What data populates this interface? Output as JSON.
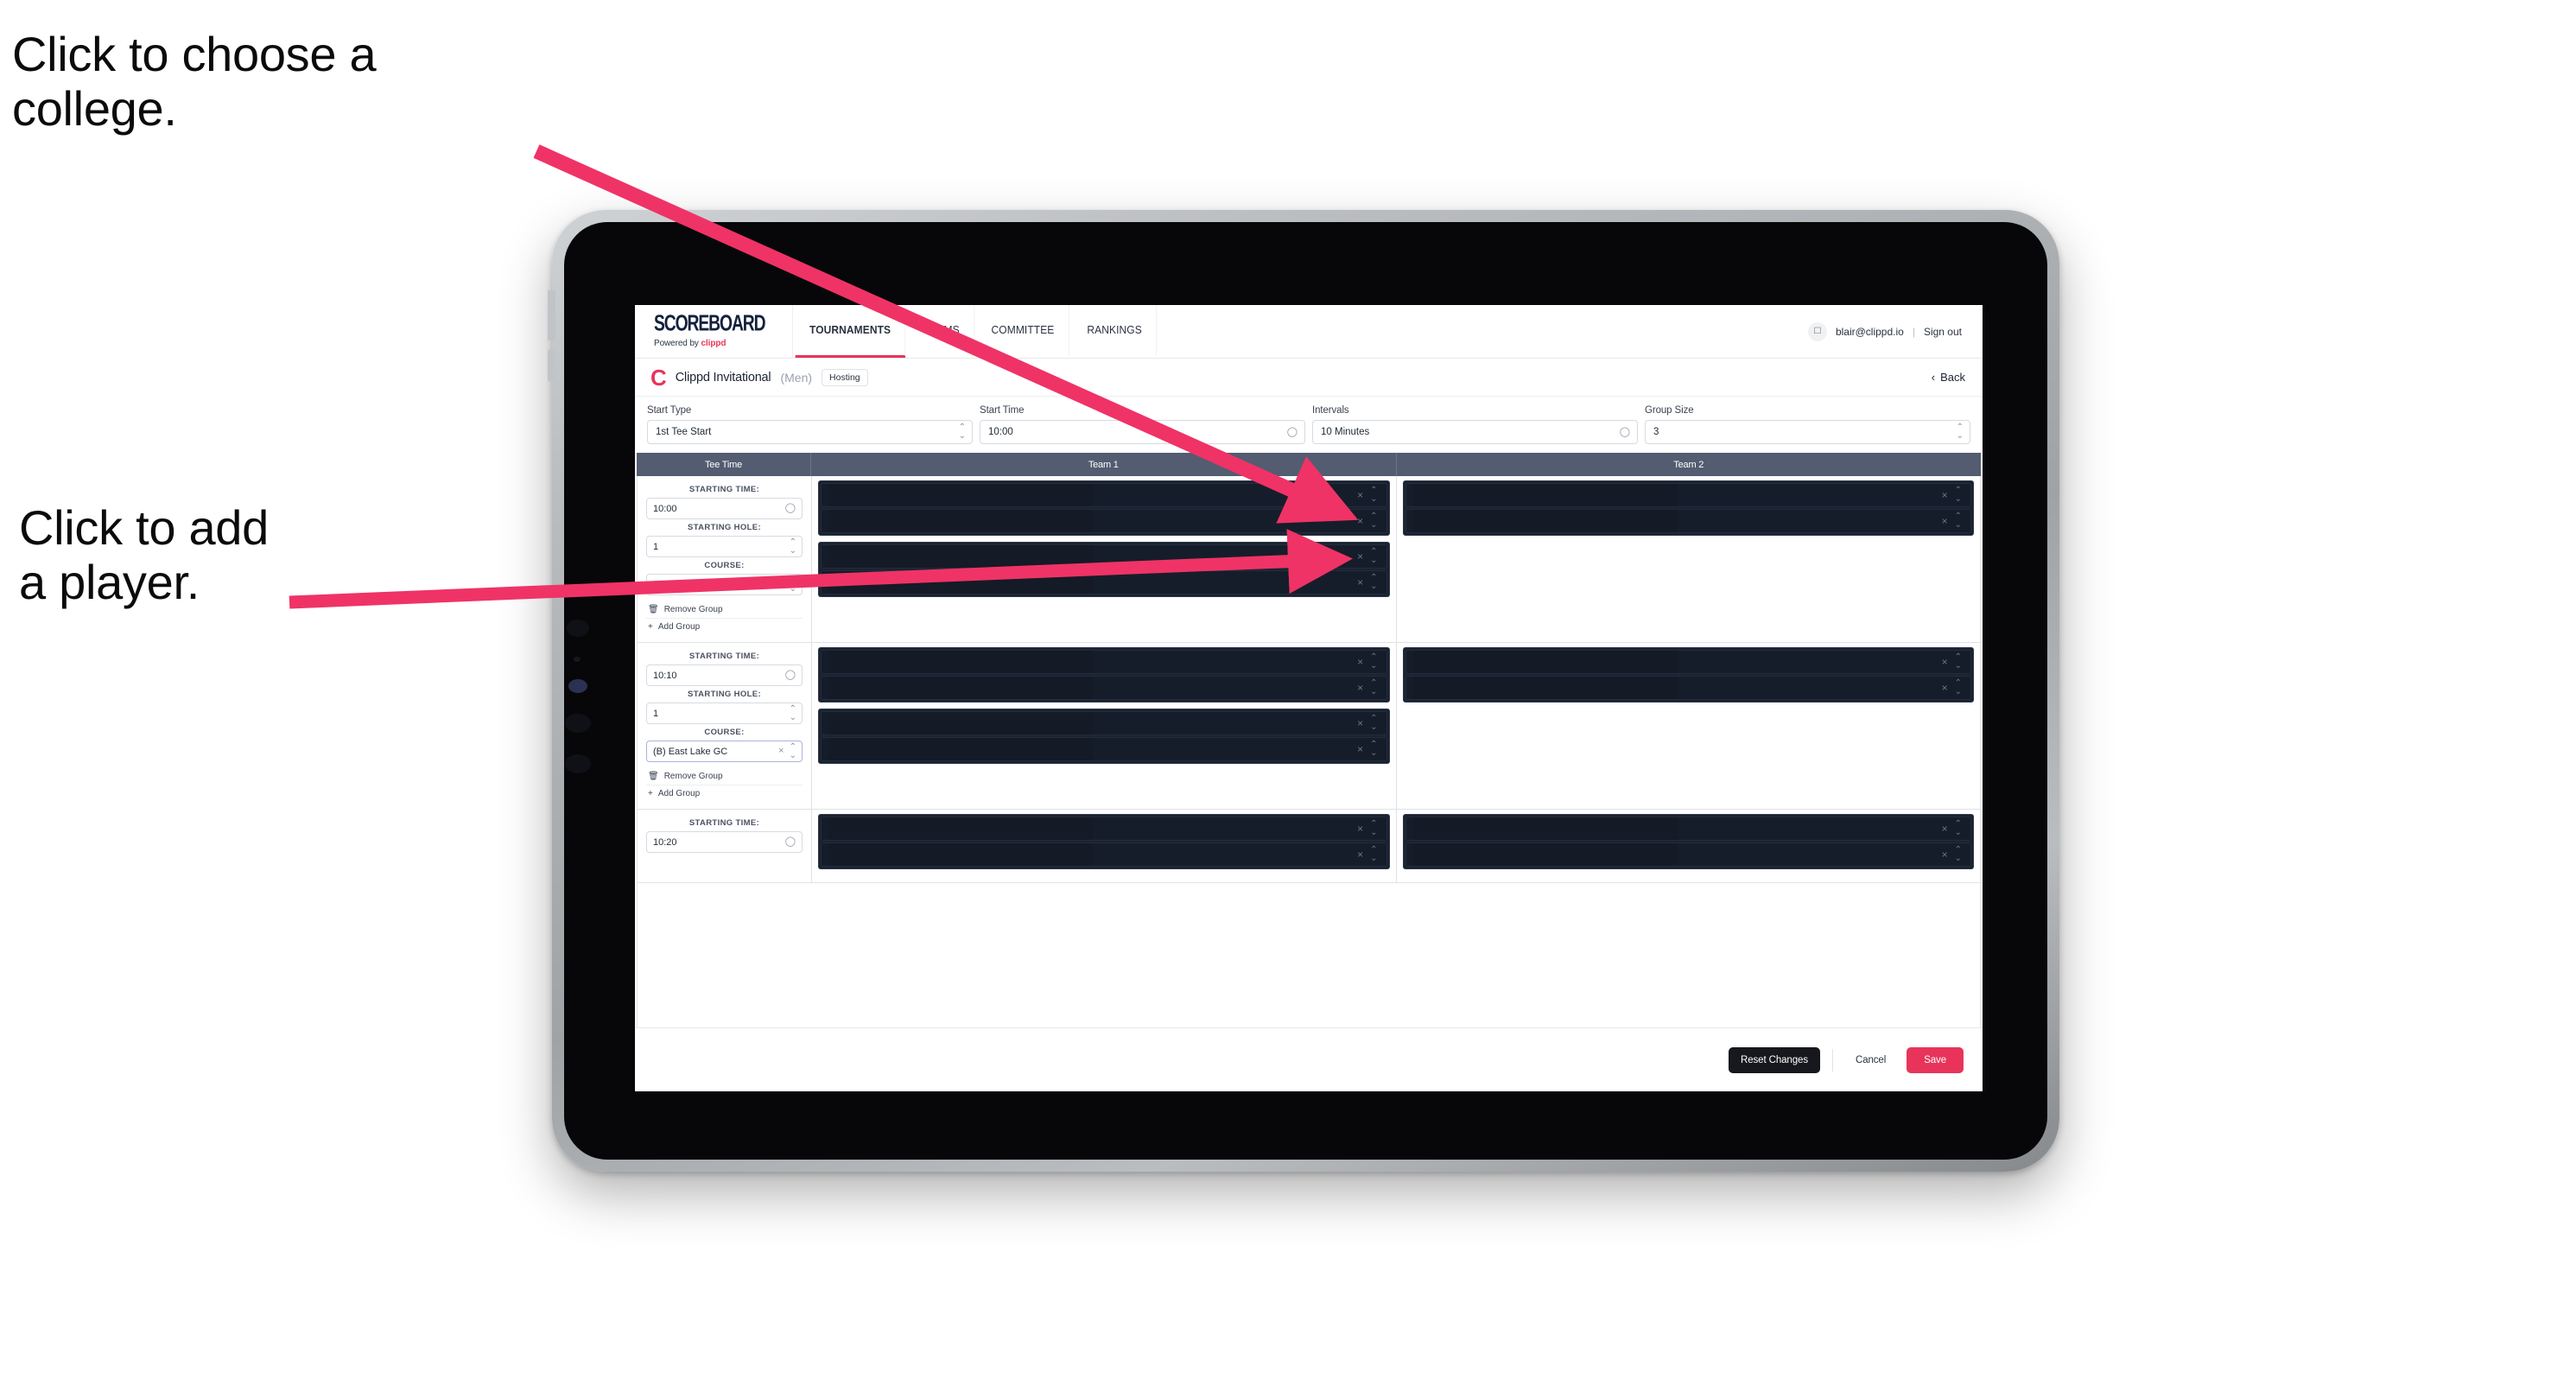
{
  "annotations": [
    {
      "id": "college",
      "text": "Click to choose a\ncollege."
    },
    {
      "id": "player",
      "text": "Click to add\na player."
    }
  ],
  "colors": {
    "accent": "#e8345a",
    "arrow": "#ef3366",
    "table_header_bg": "#535c70",
    "redact_dark": "#161d2a",
    "reset_button_bg": "#16181d"
  },
  "topnav": {
    "brand_name": "SCOREBOARD",
    "brand_sub_prefix": "Powered by ",
    "brand_sub_brand": "clippd",
    "links": [
      {
        "label": "TOURNAMENTS",
        "active": true
      },
      {
        "label": "TEAMS",
        "active": false
      },
      {
        "label": "COMMITTEE",
        "active": false
      },
      {
        "label": "RANKINGS",
        "active": false
      }
    ],
    "avatar_icon": "user-avatar-icon",
    "user_email": "blair@clippd.io",
    "separator": "|",
    "sign_out": "Sign out"
  },
  "subheader": {
    "logo_letter": "C",
    "tournament_name": "Clippd Invitational",
    "gender": "(Men)",
    "hosting_badge": "Hosting",
    "back_chevron": "‹",
    "back_label": "Back"
  },
  "controls": [
    {
      "label": "Start Type",
      "value": "1st Tee Start",
      "icon": "stepper-icon"
    },
    {
      "label": "Start Time",
      "value": "10:00",
      "icon": "clock-icon"
    },
    {
      "label": "Intervals",
      "value": "10 Minutes",
      "icon": "clock-icon"
    },
    {
      "label": "Group Size",
      "value": "3",
      "icon": "stepper-icon"
    }
  ],
  "table": {
    "headers": [
      "Tee Time",
      "Team 1",
      "Team 2"
    ],
    "field_labels": {
      "starting_time": "STARTING TIME:",
      "starting_hole": "STARTING HOLE:",
      "course": "COURSE:"
    },
    "group_actions": {
      "remove": "Remove Group",
      "remove_icon": "trash-icon",
      "add": "Add Group",
      "add_icon": "plus-icon"
    },
    "row_icons": {
      "clear": "×",
      "stepper": "⌃⌄"
    },
    "groups": [
      {
        "starting_time": "10:00",
        "starting_hole": "1",
        "course": "(A) Peachtree GC",
        "course_focused": false,
        "team1_blocks": [
          {
            "players": 2
          },
          {
            "players": 2
          }
        ],
        "team2_blocks": [
          {
            "players": 2
          }
        ]
      },
      {
        "starting_time": "10:10",
        "starting_hole": "1",
        "course": "(B) East Lake GC",
        "course_focused": true,
        "team1_blocks": [
          {
            "players": 2
          },
          {
            "players": 2
          }
        ],
        "team2_blocks": [
          {
            "players": 2
          }
        ]
      },
      {
        "starting_time": "10:20",
        "starting_hole": "",
        "course": "",
        "course_focused": false,
        "team1_blocks": [
          {
            "players": 2
          }
        ],
        "team2_blocks": [
          {
            "players": 2
          }
        ]
      }
    ]
  },
  "footer": {
    "reset": "Reset Changes",
    "cancel": "Cancel",
    "save": "Save"
  }
}
